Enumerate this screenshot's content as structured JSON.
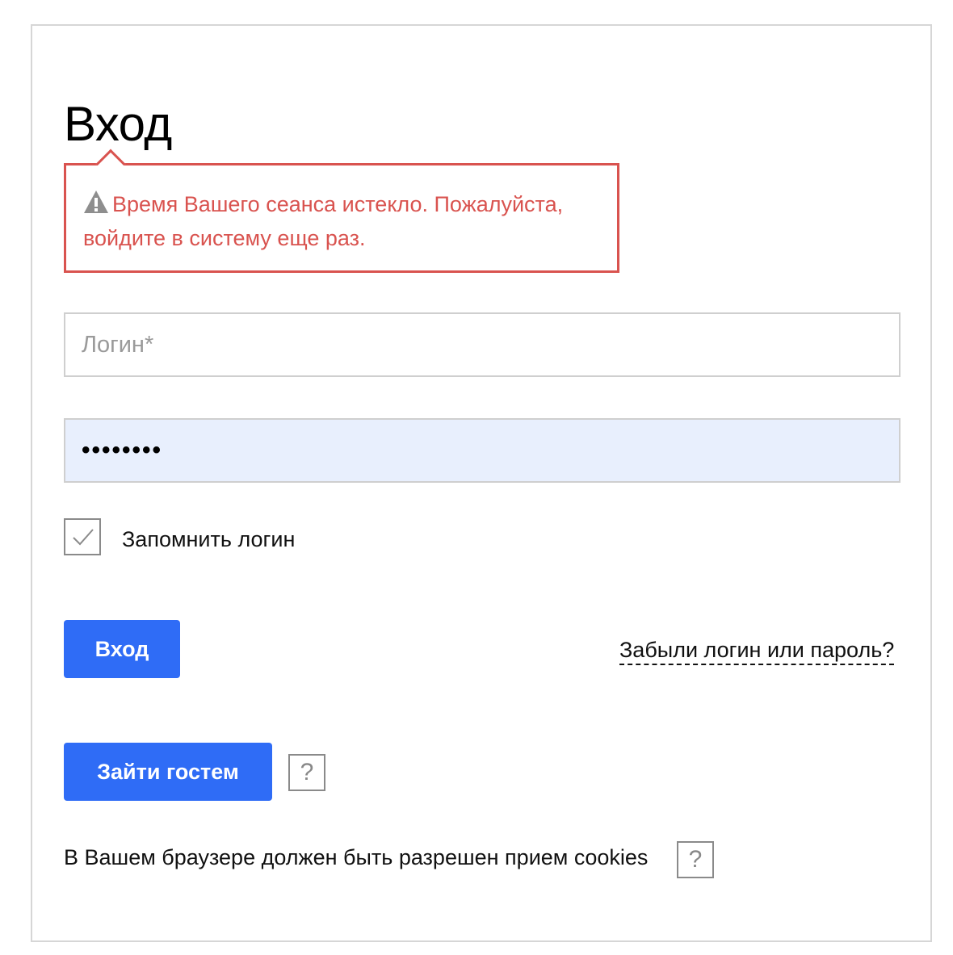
{
  "page": {
    "title": "Вход"
  },
  "alert": {
    "icon": "warning-triangle-icon",
    "message": "Время Вашего сеанса истекло. Пожалуйста, войдите в систему еще раз.",
    "color": "#d9534f"
  },
  "form": {
    "login_placeholder": "Логин*",
    "login_value": "",
    "password_value": "••••••••",
    "remember_label": "Запомнить логин",
    "remember_checked": true,
    "login_button": "Вход",
    "forgot_link": "Забыли логин или пароль?",
    "guest_button": "Зайти гостем",
    "guest_help": "?",
    "cookies_notice": "В Вашем браузере должен быть разрешен прием cookies",
    "cookies_help": "?"
  },
  "colors": {
    "accent": "#2f6cf6",
    "password_bg": "#e8effd",
    "border": "#cfcfcf"
  }
}
